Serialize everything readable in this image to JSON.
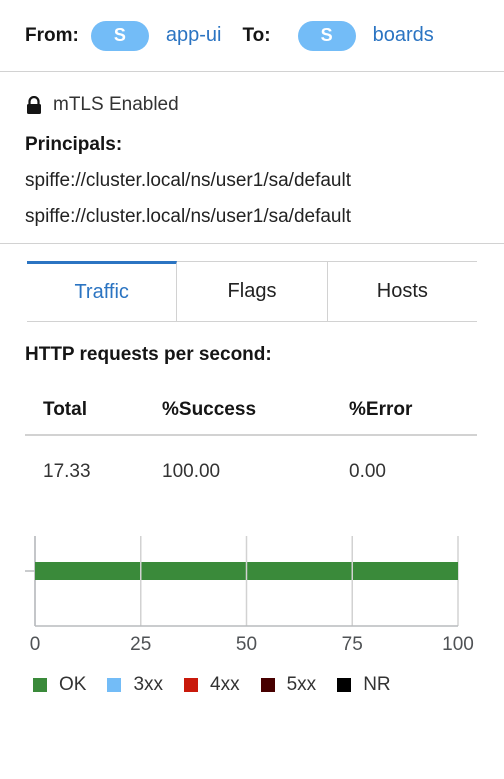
{
  "header": {
    "from_label": "From:",
    "from_badge": "S",
    "from_name": "app-ui",
    "to_label": "To:",
    "to_badge": "S",
    "to_name": "boards"
  },
  "security": {
    "mtls_text": "mTLS Enabled",
    "principals_label": "Principals:",
    "principals": [
      "spiffe://cluster.local/ns/user1/sa/default",
      "spiffe://cluster.local/ns/user1/sa/default"
    ]
  },
  "tabs": [
    {
      "label": "Traffic",
      "active": true
    },
    {
      "label": "Flags",
      "active": false
    },
    {
      "label": "Hosts",
      "active": false
    }
  ],
  "traffic": {
    "title": "HTTP requests per second:",
    "columns": [
      "Total",
      "%Success",
      "%Error"
    ],
    "row": [
      "17.33",
      "100.00",
      "0.00"
    ]
  },
  "chart_data": {
    "type": "bar",
    "orientation": "horizontal",
    "stacked": true,
    "xlim": [
      0,
      100
    ],
    "x_ticks": [
      "0",
      "25",
      "50",
      "75",
      "100"
    ],
    "grid": true,
    "series": [
      {
        "name": "OK",
        "color": "#3a8a3a",
        "values": [
          100
        ]
      },
      {
        "name": "3xx",
        "color": "#73bcf7",
        "values": [
          0
        ]
      },
      {
        "name": "4xx",
        "color": "#c9190b",
        "values": [
          0
        ]
      },
      {
        "name": "5xx",
        "color": "#470000",
        "values": [
          0
        ]
      },
      {
        "name": "NR",
        "color": "#000000",
        "values": [
          0
        ]
      }
    ],
    "legend_position": "bottom"
  }
}
